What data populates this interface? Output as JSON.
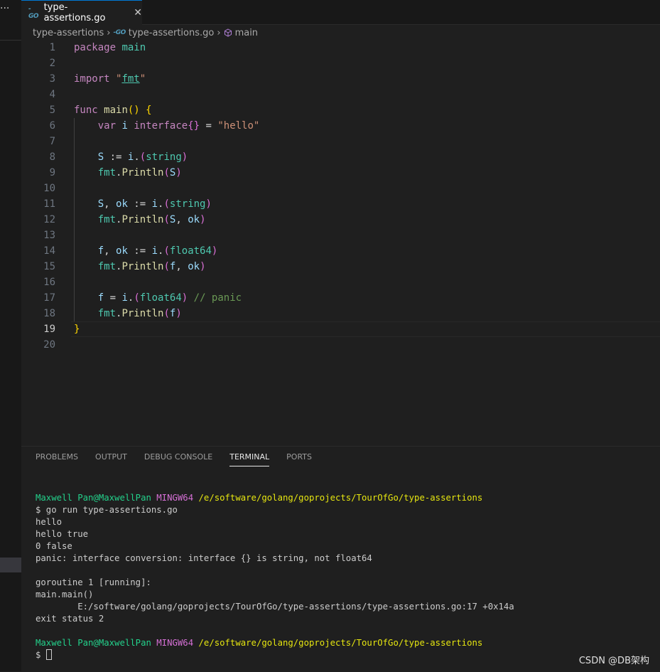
{
  "side": {
    "more_label": "···"
  },
  "tab": {
    "icon_text": "-GO",
    "title": "type-assertions.go",
    "close": "✕"
  },
  "breadcrumb": {
    "folder": "type-assertions",
    "file_icon": "-GO",
    "file": "type-assertions.go",
    "symbol": "main",
    "sep": "›"
  },
  "editor": {
    "line_numbers": [
      "1",
      "2",
      "3",
      "4",
      "5",
      "6",
      "7",
      "8",
      "9",
      "10",
      "11",
      "12",
      "13",
      "14",
      "15",
      "16",
      "17",
      "18",
      "19",
      "20"
    ],
    "active_line": 19,
    "lines": [
      [
        {
          "t": "package",
          "c": "kw"
        },
        {
          "t": " ",
          "c": "op"
        },
        {
          "t": "main",
          "c": "pkg"
        }
      ],
      [],
      [
        {
          "t": "import",
          "c": "kw"
        },
        {
          "t": " \"",
          "c": "str"
        },
        {
          "t": "fmt",
          "c": "pkg ul"
        },
        {
          "t": "\"",
          "c": "str"
        }
      ],
      [],
      [
        {
          "t": "func",
          "c": "kw"
        },
        {
          "t": " ",
          "c": "op"
        },
        {
          "t": "main",
          "c": "fn"
        },
        {
          "t": "()",
          "c": "br1"
        },
        {
          "t": " ",
          "c": "op"
        },
        {
          "t": "{",
          "c": "br1"
        }
      ],
      [
        {
          "t": "    ",
          "c": "op"
        },
        {
          "t": "var",
          "c": "kw"
        },
        {
          "t": " ",
          "c": "op"
        },
        {
          "t": "i",
          "c": "var"
        },
        {
          "t": " ",
          "c": "op"
        },
        {
          "t": "interface",
          "c": "kw"
        },
        {
          "t": "{}",
          "c": "br2"
        },
        {
          "t": " = ",
          "c": "op"
        },
        {
          "t": "\"hello\"",
          "c": "str"
        }
      ],
      [],
      [
        {
          "t": "    ",
          "c": "op"
        },
        {
          "t": "S",
          "c": "var"
        },
        {
          "t": " := ",
          "c": "op"
        },
        {
          "t": "i",
          "c": "var"
        },
        {
          "t": ".",
          "c": "op"
        },
        {
          "t": "(",
          "c": "br2"
        },
        {
          "t": "string",
          "c": "ty"
        },
        {
          "t": ")",
          "c": "br2"
        }
      ],
      [
        {
          "t": "    ",
          "c": "op"
        },
        {
          "t": "fmt",
          "c": "pkg"
        },
        {
          "t": ".",
          "c": "op"
        },
        {
          "t": "Println",
          "c": "fn"
        },
        {
          "t": "(",
          "c": "br2"
        },
        {
          "t": "S",
          "c": "var"
        },
        {
          "t": ")",
          "c": "br2"
        }
      ],
      [],
      [
        {
          "t": "    ",
          "c": "op"
        },
        {
          "t": "S",
          "c": "var"
        },
        {
          "t": ", ",
          "c": "op"
        },
        {
          "t": "ok",
          "c": "var"
        },
        {
          "t": " := ",
          "c": "op"
        },
        {
          "t": "i",
          "c": "var"
        },
        {
          "t": ".",
          "c": "op"
        },
        {
          "t": "(",
          "c": "br2"
        },
        {
          "t": "string",
          "c": "ty"
        },
        {
          "t": ")",
          "c": "br2"
        }
      ],
      [
        {
          "t": "    ",
          "c": "op"
        },
        {
          "t": "fmt",
          "c": "pkg"
        },
        {
          "t": ".",
          "c": "op"
        },
        {
          "t": "Println",
          "c": "fn"
        },
        {
          "t": "(",
          "c": "br2"
        },
        {
          "t": "S",
          "c": "var"
        },
        {
          "t": ", ",
          "c": "op"
        },
        {
          "t": "ok",
          "c": "var"
        },
        {
          "t": ")",
          "c": "br2"
        }
      ],
      [],
      [
        {
          "t": "    ",
          "c": "op"
        },
        {
          "t": "f",
          "c": "var"
        },
        {
          "t": ", ",
          "c": "op"
        },
        {
          "t": "ok",
          "c": "var"
        },
        {
          "t": " := ",
          "c": "op"
        },
        {
          "t": "i",
          "c": "var"
        },
        {
          "t": ".",
          "c": "op"
        },
        {
          "t": "(",
          "c": "br2"
        },
        {
          "t": "float64",
          "c": "ty"
        },
        {
          "t": ")",
          "c": "br2"
        }
      ],
      [
        {
          "t": "    ",
          "c": "op"
        },
        {
          "t": "fmt",
          "c": "pkg"
        },
        {
          "t": ".",
          "c": "op"
        },
        {
          "t": "Println",
          "c": "fn"
        },
        {
          "t": "(",
          "c": "br2"
        },
        {
          "t": "f",
          "c": "var"
        },
        {
          "t": ", ",
          "c": "op"
        },
        {
          "t": "ok",
          "c": "var"
        },
        {
          "t": ")",
          "c": "br2"
        }
      ],
      [],
      [
        {
          "t": "    ",
          "c": "op"
        },
        {
          "t": "f",
          "c": "var"
        },
        {
          "t": " = ",
          "c": "op"
        },
        {
          "t": "i",
          "c": "var"
        },
        {
          "t": ".",
          "c": "op"
        },
        {
          "t": "(",
          "c": "br2"
        },
        {
          "t": "float64",
          "c": "ty"
        },
        {
          "t": ")",
          "c": "br2"
        },
        {
          "t": " // panic",
          "c": "cm"
        }
      ],
      [
        {
          "t": "    ",
          "c": "op"
        },
        {
          "t": "fmt",
          "c": "pkg"
        },
        {
          "t": ".",
          "c": "op"
        },
        {
          "t": "Println",
          "c": "fn"
        },
        {
          "t": "(",
          "c": "br2"
        },
        {
          "t": "f",
          "c": "var"
        },
        {
          "t": ")",
          "c": "br2"
        }
      ],
      [
        {
          "t": "}",
          "c": "br1"
        }
      ],
      []
    ]
  },
  "panel": {
    "tabs": [
      "PROBLEMS",
      "OUTPUT",
      "DEBUG CONSOLE",
      "TERMINAL",
      "PORTS"
    ],
    "active_tab": "TERMINAL"
  },
  "terminal": {
    "lines": [
      [
        {
          "t": "Maxwell Pan@MaxwellPan",
          "c": "t-green"
        },
        {
          "t": " ",
          "c": ""
        },
        {
          "t": "MINGW64",
          "c": "t-magenta"
        },
        {
          "t": " ",
          "c": ""
        },
        {
          "t": "/e/software/golang/goprojects/TourOfGo/type-assertions",
          "c": "t-yellow"
        }
      ],
      [
        {
          "t": "$ go run type-assertions.go",
          "c": ""
        }
      ],
      [
        {
          "t": "hello",
          "c": ""
        }
      ],
      [
        {
          "t": "hello true",
          "c": ""
        }
      ],
      [
        {
          "t": "0 false",
          "c": ""
        }
      ],
      [
        {
          "t": "panic: interface conversion: interface {} is string, not float64",
          "c": ""
        }
      ],
      [],
      [
        {
          "t": "goroutine 1 [running]:",
          "c": ""
        }
      ],
      [
        {
          "t": "main.main()",
          "c": ""
        }
      ],
      [
        {
          "t": "        E:/software/golang/goprojects/TourOfGo/type-assertions/type-assertions.go:17 +0x14a",
          "c": ""
        }
      ],
      [
        {
          "t": "exit status 2",
          "c": ""
        }
      ],
      [],
      [
        {
          "t": "Maxwell Pan@MaxwellPan",
          "c": "t-green"
        },
        {
          "t": " ",
          "c": ""
        },
        {
          "t": "MINGW64",
          "c": "t-magenta"
        },
        {
          "t": " ",
          "c": ""
        },
        {
          "t": "/e/software/golang/goprojects/TourOfGo/type-assertions",
          "c": "t-yellow"
        }
      ]
    ],
    "prompt": "$ "
  },
  "watermark": "CSDN @DB架构",
  "colors": {
    "accent": "#0078d4",
    "background": "#1f1f1f",
    "terminal_user": "#23d18b",
    "terminal_host": "#d670d6",
    "terminal_path": "#e5e510"
  }
}
